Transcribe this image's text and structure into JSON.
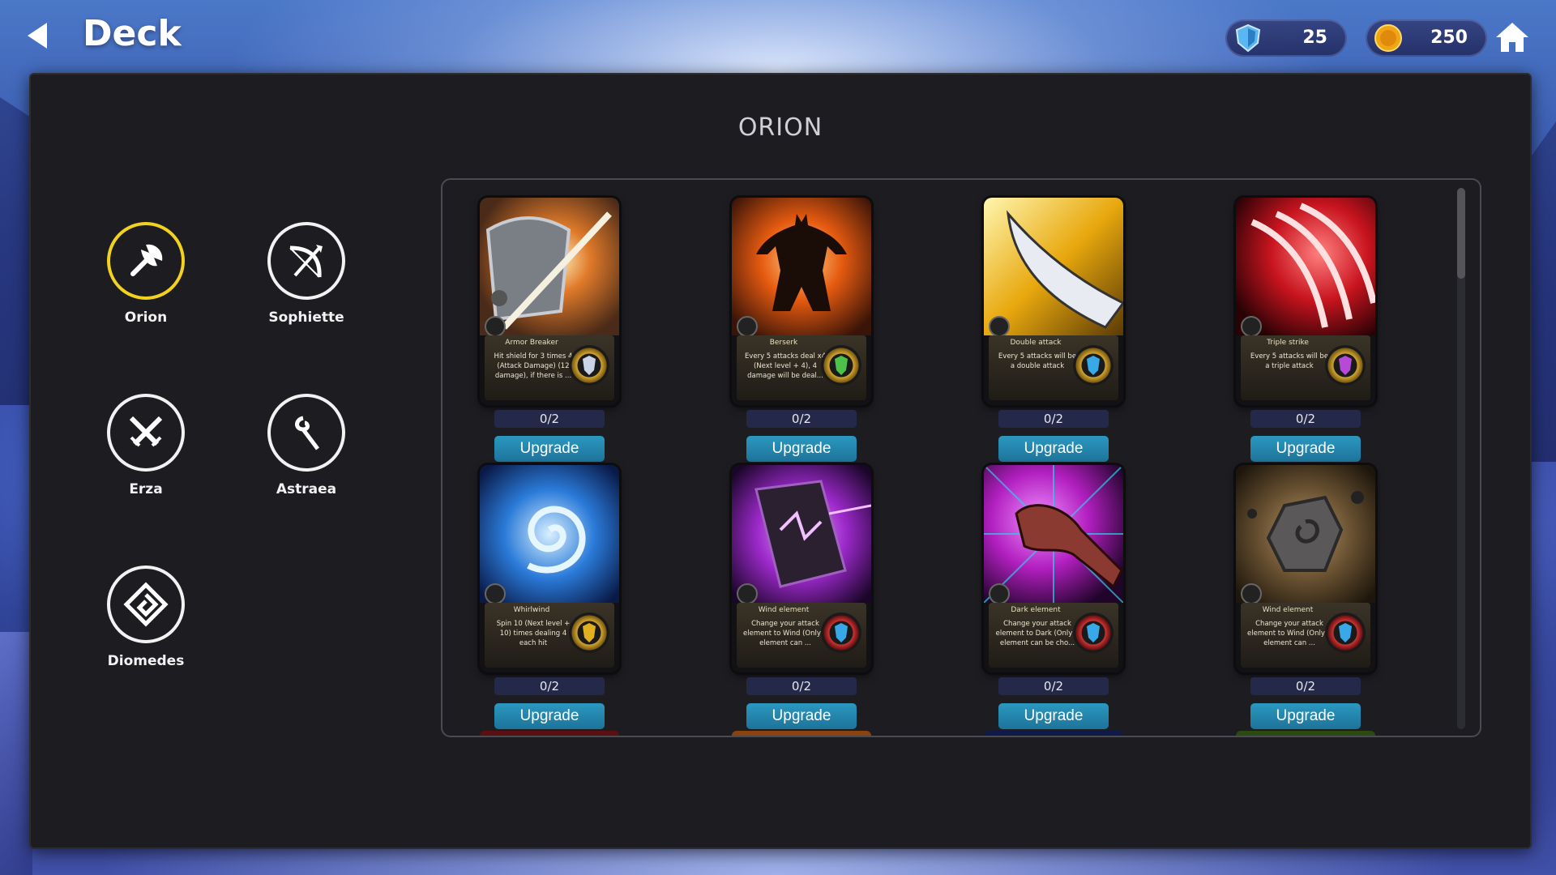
{
  "header": {
    "title": "Deck"
  },
  "currencies": {
    "gems": "25",
    "coins": "250"
  },
  "panel": {
    "hero_name": "ORION"
  },
  "heroes": [
    {
      "name": "Orion",
      "icon": "axe-icon",
      "selected": true
    },
    {
      "name": "Sophiette",
      "icon": "bow-icon",
      "selected": false
    },
    {
      "name": "Erza",
      "icon": "crossed-swords-icon",
      "selected": false
    },
    {
      "name": "Astraea",
      "icon": "staff-icon",
      "selected": false
    },
    {
      "name": "Diomedes",
      "icon": "diamond-emblem-icon",
      "selected": false
    }
  ],
  "cards": [
    {
      "name": "Armor Breaker",
      "desc": "Hit shield for 3 times 4 (Attack Damage) (12 damage), if there is ...",
      "progress": "0/2",
      "button": "Upgrade",
      "art": "armor-breaker-art",
      "accent": "#e07a2a",
      "gem_color": "#c9d4e6"
    },
    {
      "name": "Berserk",
      "desc": "Every 5 attacks deal x4 (Next level + 4), 4 damage will be deal...",
      "progress": "0/2",
      "button": "Upgrade",
      "art": "berserk-art",
      "accent": "#e55a10",
      "gem_color": "#4cc24a"
    },
    {
      "name": "Double attack",
      "desc": "Every 5 attacks will be a double attack",
      "progress": "0/2",
      "button": "Upgrade",
      "art": "double-attack-art",
      "accent": "#e8a80e",
      "gem_color": "#39a8e8"
    },
    {
      "name": "Triple strike",
      "desc": "Every 5 attacks will be a triple attack",
      "progress": "0/2",
      "button": "Upgrade",
      "art": "triple-strike-art",
      "accent": "#c8141e",
      "gem_color": "#b44ad6"
    },
    {
      "name": "Whirlwind",
      "desc": "Spin 10 (Next level + 10) times dealing 4 each hit",
      "progress": "0/2",
      "button": "Upgrade",
      "art": "whirlwind-art",
      "accent": "#2a7ad8",
      "gem_color": "#e0b021"
    },
    {
      "name": "Wind element",
      "desc": "Change your attack element to Wind (Only 1 element can ...",
      "progress": "0/2",
      "button": "Upgrade",
      "art": "wind-element-scroll-art",
      "accent": "#9a28c8",
      "gem_color": "#39a8e8"
    },
    {
      "name": "Dark element",
      "desc": "Change your attack element to Dark (Only 1 element can be cho...",
      "progress": "0/2",
      "button": "Upgrade",
      "art": "dark-element-art",
      "accent": "#b21fc0",
      "gem_color": "#39a8e8"
    },
    {
      "name": "Wind element",
      "desc": "Change your attack element to Wind (Only 1 element can ...",
      "progress": "0/2",
      "button": "Upgrade",
      "art": "wind-element-rock-art",
      "accent": "#6a5232",
      "gem_color": "#39a8e8"
    }
  ],
  "colors": {
    "accent_yellow": "#f2d21e",
    "button_blue": "#1d86b0",
    "panel_bg": "#1d1c21"
  }
}
